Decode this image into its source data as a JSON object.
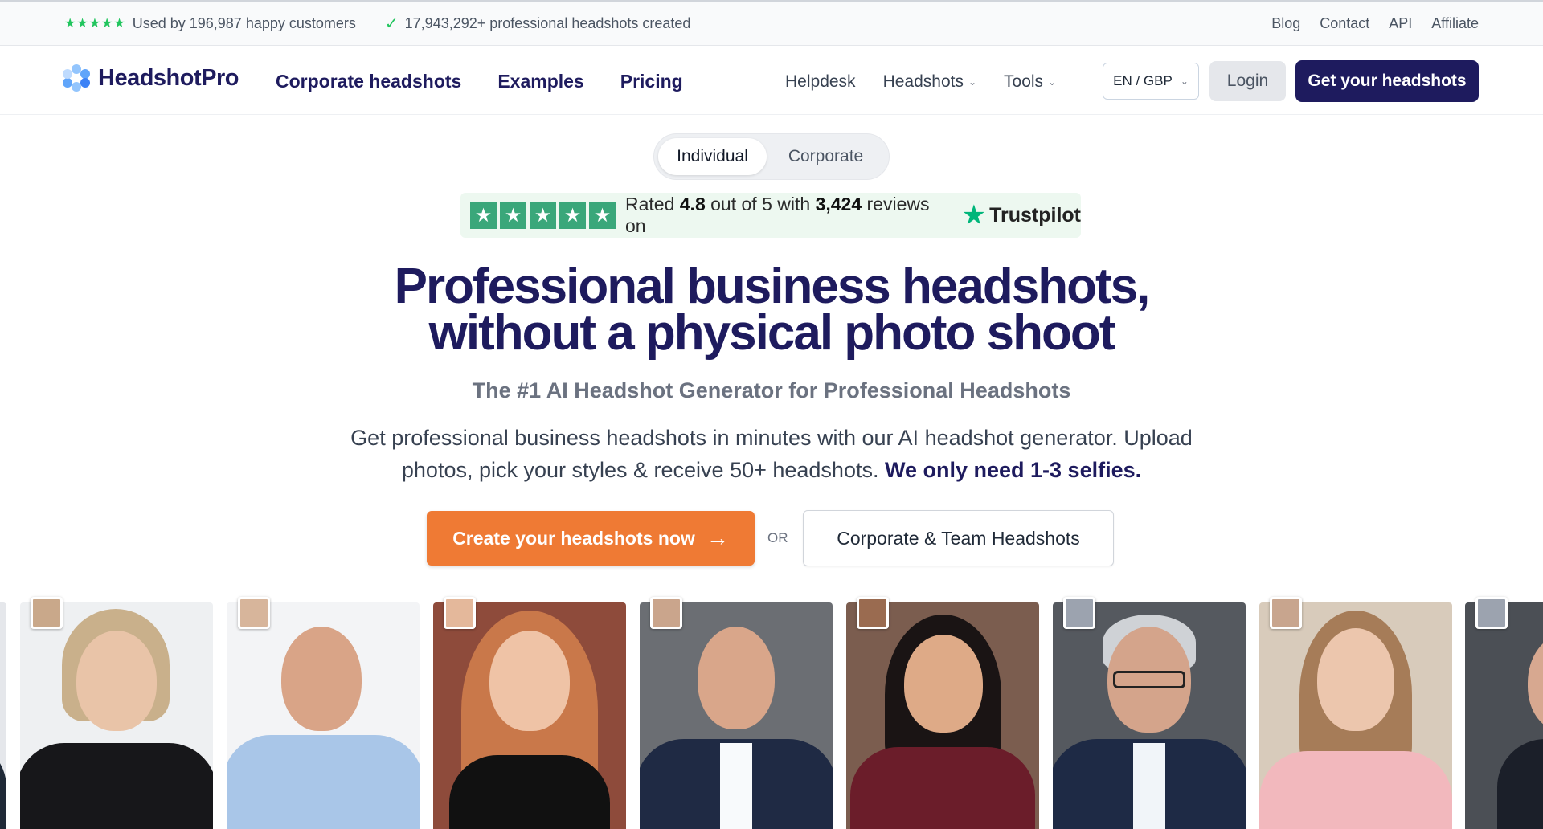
{
  "topbar": {
    "stars": "★★★★★",
    "customers_text": "Used by 196,987 happy customers",
    "check": "✓",
    "headshots_text": "17,943,292+ professional headshots created",
    "links": [
      "Blog",
      "Contact",
      "API",
      "Affiliate"
    ]
  },
  "nav": {
    "logo": "HeadshotPro",
    "main_links": [
      "Corporate headshots",
      "Examples",
      "Pricing"
    ],
    "helpdesk": "Helpdesk",
    "headshots": "Headshots",
    "tools": "Tools",
    "lang": "EN / GBP",
    "login": "Login",
    "get_headshots": "Get your headshots"
  },
  "toggle": {
    "individual": "Individual",
    "corporate": "Corporate"
  },
  "trustpilot": {
    "rated": "Rated",
    "rating": "4.8",
    "out_of": "out of 5 with",
    "reviews": "3,424",
    "reviews_on": "reviews on",
    "brand": "Trustpilot"
  },
  "hero": {
    "title_line1": "Professional business headshots,",
    "title_line2": "without a physical photo shoot",
    "subtitle": "The #1 AI Headshot Generator for Professional Headshots",
    "desc_part1": "Get professional business headshots in minutes with our AI headshot generator. Upload photos, pick your styles & receive 50+ headshots.",
    "desc_bold": "We only need 1-3 selfies.",
    "cta_primary": "Create your headshots now",
    "cta_arrow": "→",
    "or": "OR",
    "cta_secondary": "Corporate & Team Headshots"
  },
  "colors": {
    "navy": "#1e1b5e",
    "orange": "#ef7a34",
    "trustpilot_green": "#00b67a",
    "star_green": "#22c55e"
  },
  "photos": [
    {
      "name": "woman-blonde"
    },
    {
      "name": "man-bald-blue-shirt"
    },
    {
      "name": "woman-red-hair"
    },
    {
      "name": "man-bald-navy-suit"
    },
    {
      "name": "woman-dark-hair"
    },
    {
      "name": "man-glasses-suit"
    },
    {
      "name": "woman-pink-top"
    },
    {
      "name": "man-suit-partial"
    }
  ]
}
